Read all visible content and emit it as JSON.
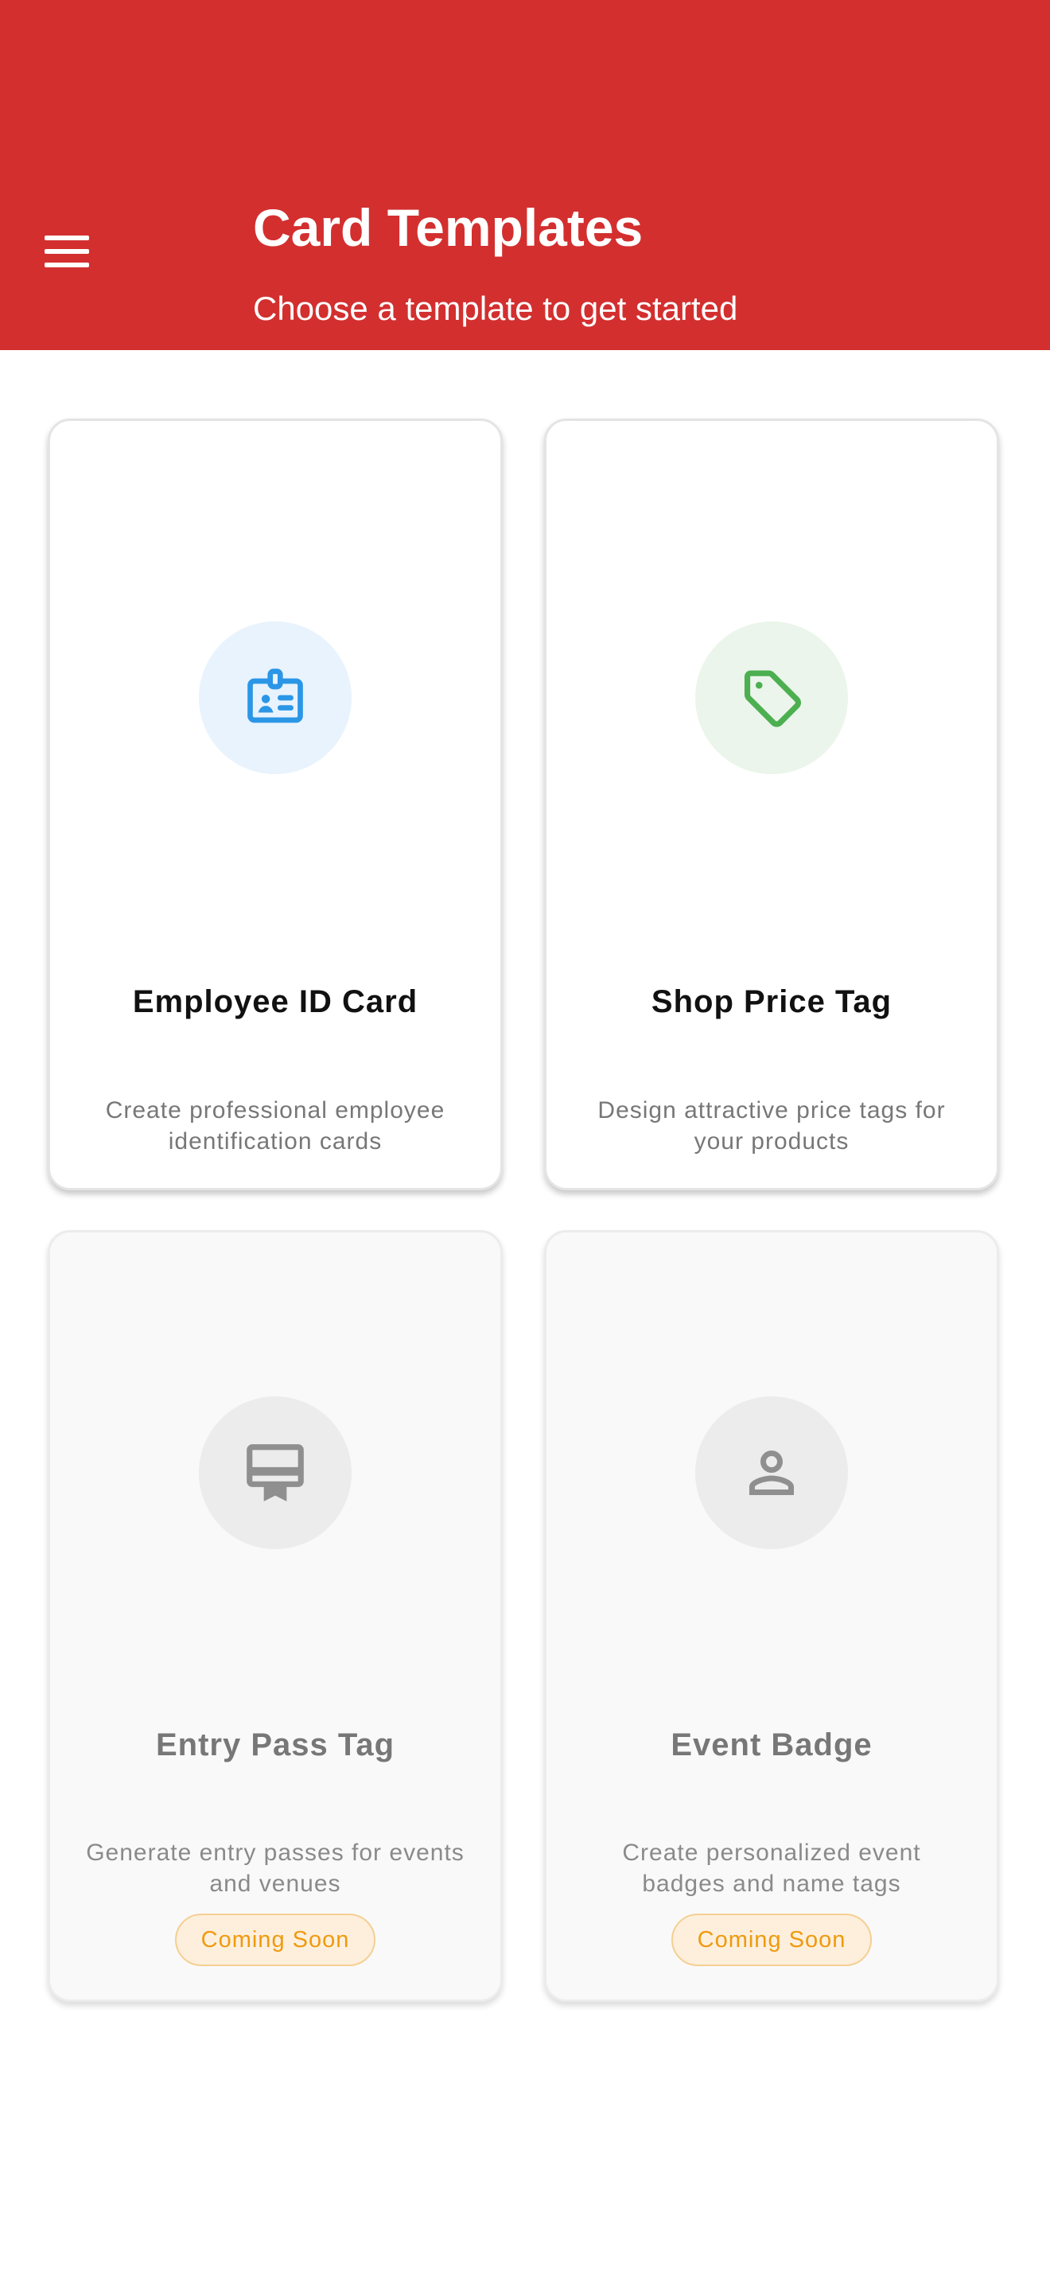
{
  "header": {
    "title": "Card Templates",
    "subtitle": "Choose a template to get started",
    "background_color": "#d32f2f",
    "menu_icon": "hamburger-menu-icon"
  },
  "templates": [
    {
      "title": "Employee ID Card",
      "description": "Create professional employee identification cards",
      "icon": "id-badge-icon",
      "icon_color": "#2b96e6",
      "icon_bg": "#e8f3fd",
      "available": true
    },
    {
      "title": "Shop Price Tag",
      "description": "Design attractive price tags for your products",
      "icon": "price-tag-icon",
      "icon_color": "#4caf50",
      "icon_bg": "#ebf5eb",
      "available": true
    },
    {
      "title": "Entry Pass Tag",
      "description": "Generate entry passes for events and venues",
      "icon": "card-membership-icon",
      "icon_color": "#8f8f8f",
      "icon_bg": "#ececec",
      "available": false,
      "badge": "Coming Soon"
    },
    {
      "title": "Event Badge",
      "description": "Create personalized event badges and name tags",
      "icon": "person-icon",
      "icon_color": "#8f8f8f",
      "icon_bg": "#ececec",
      "available": false,
      "badge": "Coming Soon"
    }
  ],
  "badge_colors": {
    "text": "#ef9a0f",
    "background": "#fdefdc",
    "border": "#f5cf93"
  }
}
